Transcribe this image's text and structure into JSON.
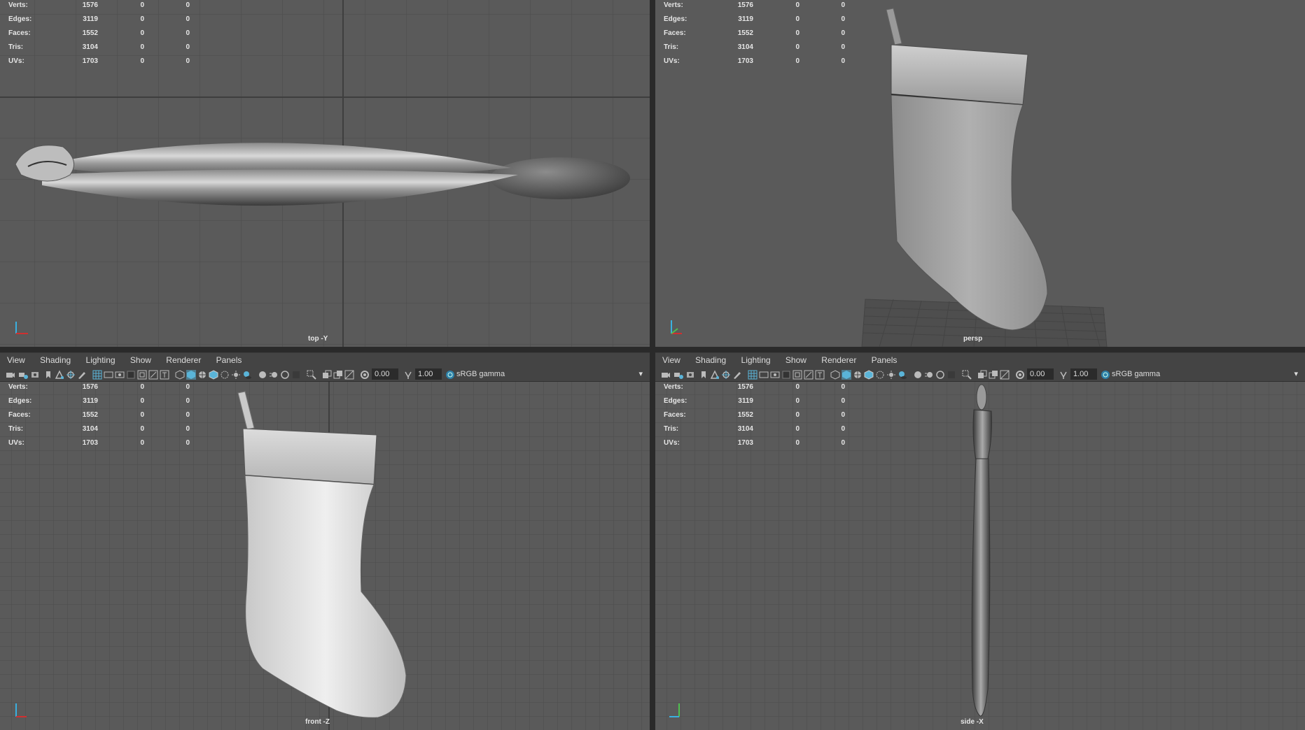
{
  "stats": [
    {
      "label": "Verts:",
      "v1": "1576",
      "v2": "0",
      "v3": "0"
    },
    {
      "label": "Edges:",
      "v1": "3119",
      "v2": "0",
      "v3": "0"
    },
    {
      "label": "Faces:",
      "v1": "1552",
      "v2": "0",
      "v3": "0"
    },
    {
      "label": "Tris:",
      "v1": "3104",
      "v2": "0",
      "v3": "0"
    },
    {
      "label": "UVs:",
      "v1": "1703",
      "v2": "0",
      "v3": "0"
    }
  ],
  "viewports": {
    "top": {
      "camera": "top -Y"
    },
    "persp": {
      "camera": "persp"
    },
    "front": {
      "camera": "front -Z"
    },
    "side": {
      "camera": "side -X"
    }
  },
  "menu": {
    "view": "View",
    "shading": "Shading",
    "lighting": "Lighting",
    "show": "Show",
    "renderer": "Renderer",
    "panels": "Panels"
  },
  "toolbar": {
    "exposure": "0.00",
    "gamma_value": "1.00",
    "color_space": "sRGB gamma"
  },
  "colors": {
    "viewport_bg": "#5a5a5a",
    "grid": "#4a4a4a",
    "panel_bg": "#444444",
    "accent": "#5ab4d8",
    "hud_text": "#e6e6e6"
  }
}
